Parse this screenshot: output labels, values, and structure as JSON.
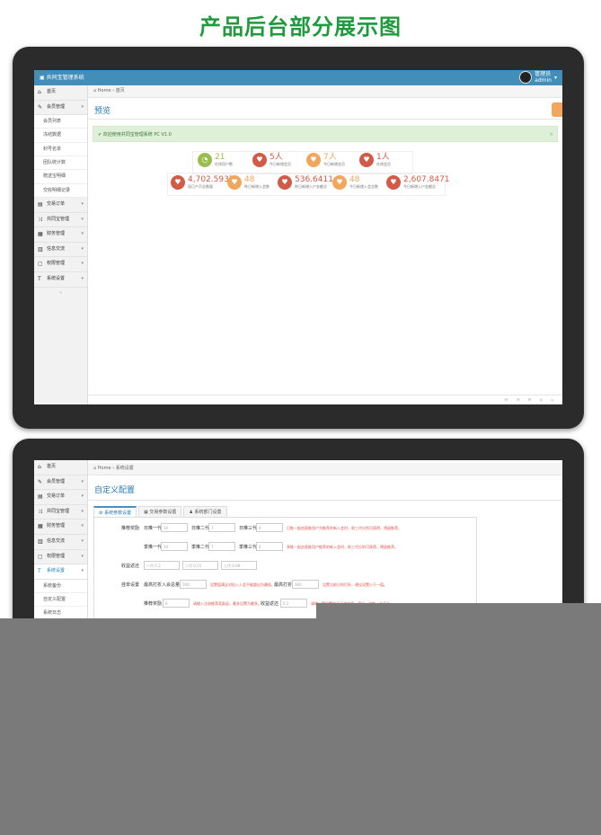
{
  "headline": "产品后台部分展示图",
  "screen1": {
    "app_title": "共同宝管理系统",
    "user": {
      "name": "管理员",
      "role": "admin"
    },
    "breadcrumb": {
      "home": "Home",
      "current": "首页"
    },
    "page_title": "预览",
    "alert": "欢迎使用共同宝管理系统 PC V1.0",
    "sidebar": {
      "items": [
        {
          "label": "首页",
          "icon": "home-icon"
        },
        {
          "label": "会员管理",
          "icon": "edit-icon",
          "open": true,
          "subs": [
            "会员列表",
            "冻结数据",
            "封号名单",
            "团队统计数",
            "赠送宝明细",
            "交收明细记录"
          ]
        },
        {
          "label": "交易订单",
          "icon": "book-icon"
        },
        {
          "label": "共同宝管理",
          "icon": "shuffle-icon"
        },
        {
          "label": "财务管理",
          "icon": "calendar-icon"
        },
        {
          "label": "信息交流",
          "icon": "table-icon"
        },
        {
          "label": "权限管理",
          "icon": "file-icon"
        },
        {
          "label": "系统设置",
          "icon": "text-icon"
        }
      ]
    },
    "stats_row1": [
      {
        "value": "21",
        "label": "在线用户数",
        "color": "#9bbd4d"
      },
      {
        "value": "5人",
        "label": "今日新增会员",
        "color": "#d15b47"
      },
      {
        "value": "7人",
        "label": "今日新增会员",
        "color": "#f2a65c"
      },
      {
        "value": "1人",
        "label": "在线会员",
        "color": "#d15b47"
      }
    ],
    "stats_row2": [
      {
        "value": "4,702.5937",
        "label": "现已产币总数量",
        "color": "#d15b47"
      },
      {
        "value": "48",
        "label": "昨日新增入会数",
        "color": "#f2a65c"
      },
      {
        "value": "536.6411",
        "label": "昨日新增入户金额总",
        "color": "#d15b47"
      },
      {
        "value": "48",
        "label": "今日新增入会总数",
        "color": "#f2a65c"
      },
      {
        "value": "2,607.8471",
        "label": "今日新增入户金额总",
        "color": "#d15b47"
      }
    ]
  },
  "screen2": {
    "breadcrumb": {
      "home": "Home",
      "current": "系统设置"
    },
    "page_title": "自定义配置",
    "sidebar": {
      "items": [
        {
          "label": "首页",
          "icon": "home-icon"
        },
        {
          "label": "会员管理",
          "icon": "edit-icon"
        },
        {
          "label": "交易订单",
          "icon": "book-icon"
        },
        {
          "label": "共同宝管理",
          "icon": "shuffle-icon"
        },
        {
          "label": "财务管理",
          "icon": "calendar-icon"
        },
        {
          "label": "信息交流",
          "icon": "table-icon"
        },
        {
          "label": "权限管理",
          "icon": "file-icon"
        },
        {
          "label": "系统设置",
          "icon": "text-icon",
          "active": true
        }
      ],
      "subs": [
        "系统备份",
        "自定义配置",
        "系统日志"
      ]
    },
    "tabs": [
      "系统参数设置",
      "交易参数设置",
      "系统部门设置"
    ],
    "form": {
      "row1": {
        "label": "推荐奖励",
        "f1": "日推一代",
        "v1": "10",
        "f2": "日推二代",
        "v2": "7",
        "f3": "日推三代",
        "v3": "4",
        "hint": "日推一起由直推用户为推荐的新入会时，前三代分别可获得，预留推荐。"
      },
      "row2": {
        "f1": "季推一代",
        "v1": "10",
        "f2": "季推二代",
        "v2": "7",
        "f3": "季推三代",
        "v3": "4",
        "hint": "季推一起由直推用户推荐的新入会时，前三代分别可获得，预留推荐。"
      },
      "row3": {
        "label": "收益返还",
        "v1": "一代 0.2",
        "v2": "二代 0.15",
        "v3": "三代 0.08"
      },
      "row4": {
        "label": "挂单设置",
        "f1": "最高打折入会总量",
        "v1": "500",
        "hint1": "设置值满足对挂入入会不能超出为最低。",
        "f2": "最高打折",
        "v2": "300",
        "hint2": "设置当前日利打折，建议设置小于一值。"
      },
      "row5": {
        "f1": "推荐奖励",
        "v1": "0",
        "hint1": "请输入注册推荐奖励返，最多设置为最多。",
        "f2": "收益返还",
        "v2": "0.2",
        "hint2": "请输入需设置的返还收益值，建议一次性一个不大。"
      }
    }
  }
}
